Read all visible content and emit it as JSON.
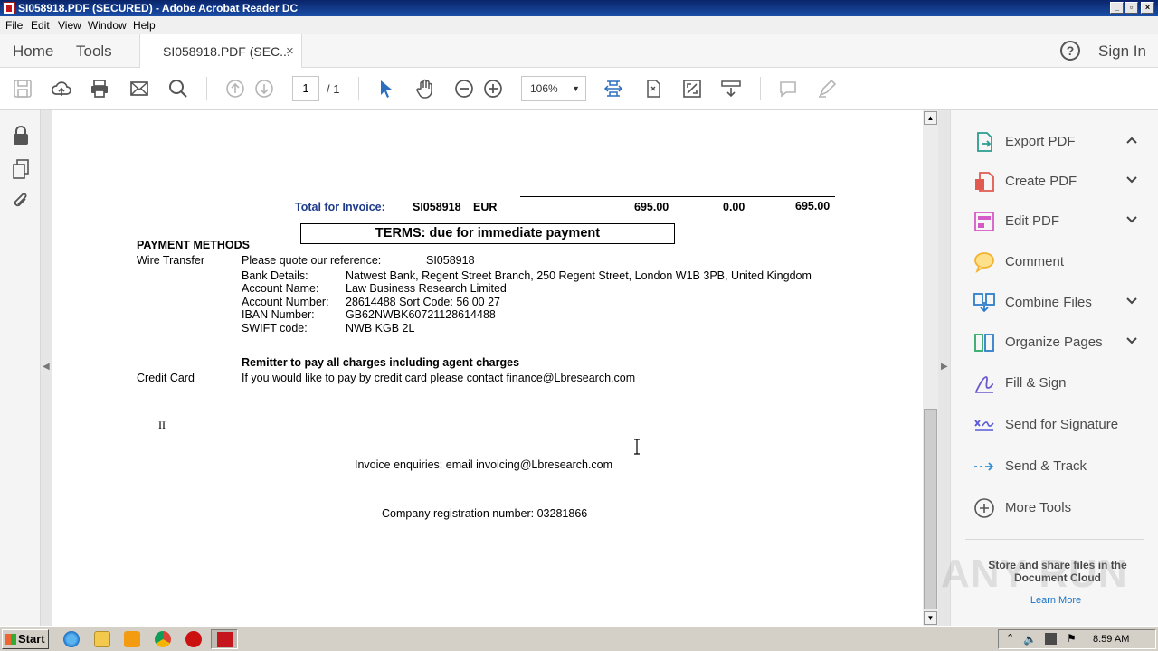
{
  "window": {
    "title": "SI058918.PDF (SECURED) - Adobe Acrobat Reader DC",
    "controls": [
      "_",
      "▫",
      "×"
    ]
  },
  "menu": [
    "File",
    "Edit",
    "View",
    "Window",
    "Help"
  ],
  "tabs": {
    "home": "Home",
    "tools": "Tools",
    "document": "SI058918.PDF (SEC...",
    "close": "×",
    "help": "?",
    "sign_in": "Sign In"
  },
  "toolbar": {
    "page_current": "1",
    "page_total": "/ 1",
    "zoom": "106%"
  },
  "document": {
    "total_label": "Total for Invoice:",
    "invoice_no": "SI058918",
    "currency": "EUR",
    "net": "695.00",
    "tax": "0.00",
    "gross": "695.00",
    "terms": "TERMS: due for immediate payment",
    "payment_methods": "PAYMENT METHODS",
    "wire_transfer": "Wire Transfer",
    "quote_ref_label": "Please quote our reference:",
    "quote_ref_value": "SI058918",
    "bank_details_label": "Bank Details:",
    "bank_details_value": "Natwest Bank, Regent Street Branch, 250 Regent Street, London W1B 3PB, United Kingdom",
    "account_name_label": "Account Name:",
    "account_name_value": "Law Business Research Limited",
    "account_number_label": "Account Number:",
    "account_number_value": "28614488 Sort Code: 56 00 27",
    "iban_label": "IBAN Number:",
    "iban_value": "GB62NWBK60721128614488",
    "swift_label": "SWIFT code:",
    "swift_value": "NWB KGB 2L",
    "remitter": "Remitter to pay all charges including agent charges",
    "credit_card": "Credit Card",
    "credit_card_text": "If you would like to pay by credit card please contact finance@Lbresearch.com",
    "marker": "II",
    "enquiries": "Invoice enquiries: email invoicing@Lbresearch.com",
    "company_reg": "Company registration number: 03281866"
  },
  "tools_pane": {
    "items": [
      {
        "label": "Export PDF",
        "expanded": true,
        "color": "#2a9d8f"
      },
      {
        "label": "Create PDF",
        "expanded": false,
        "color": "#e05a4f"
      },
      {
        "label": "Edit PDF",
        "expanded": false,
        "color": "#d45ac6"
      },
      {
        "label": "Comment",
        "expanded": false,
        "color": "#f2b230"
      },
      {
        "label": "Combine Files",
        "expanded": false,
        "color": "#2f7ec9"
      },
      {
        "label": "Organize Pages",
        "expanded": false,
        "color": "#2fa866"
      },
      {
        "label": "Fill & Sign",
        "expanded": false,
        "color": "#6a5acd"
      },
      {
        "label": "Send for Signature",
        "expanded": false,
        "color": "#5a5ad6"
      },
      {
        "label": "Send & Track",
        "expanded": false,
        "color": "#2f8fd1"
      },
      {
        "label": "More Tools",
        "expanded": false,
        "color": "#555555"
      }
    ],
    "cloud_text": "Store and share files in the Document Cloud",
    "learn_more": "Learn More"
  },
  "watermark": "ANY RUN",
  "taskbar": {
    "start": "Start",
    "clock": "8:59 AM"
  },
  "colors": {
    "accent_blue": "#2c6fbe",
    "doc_blue_label": "#1f3c88"
  }
}
